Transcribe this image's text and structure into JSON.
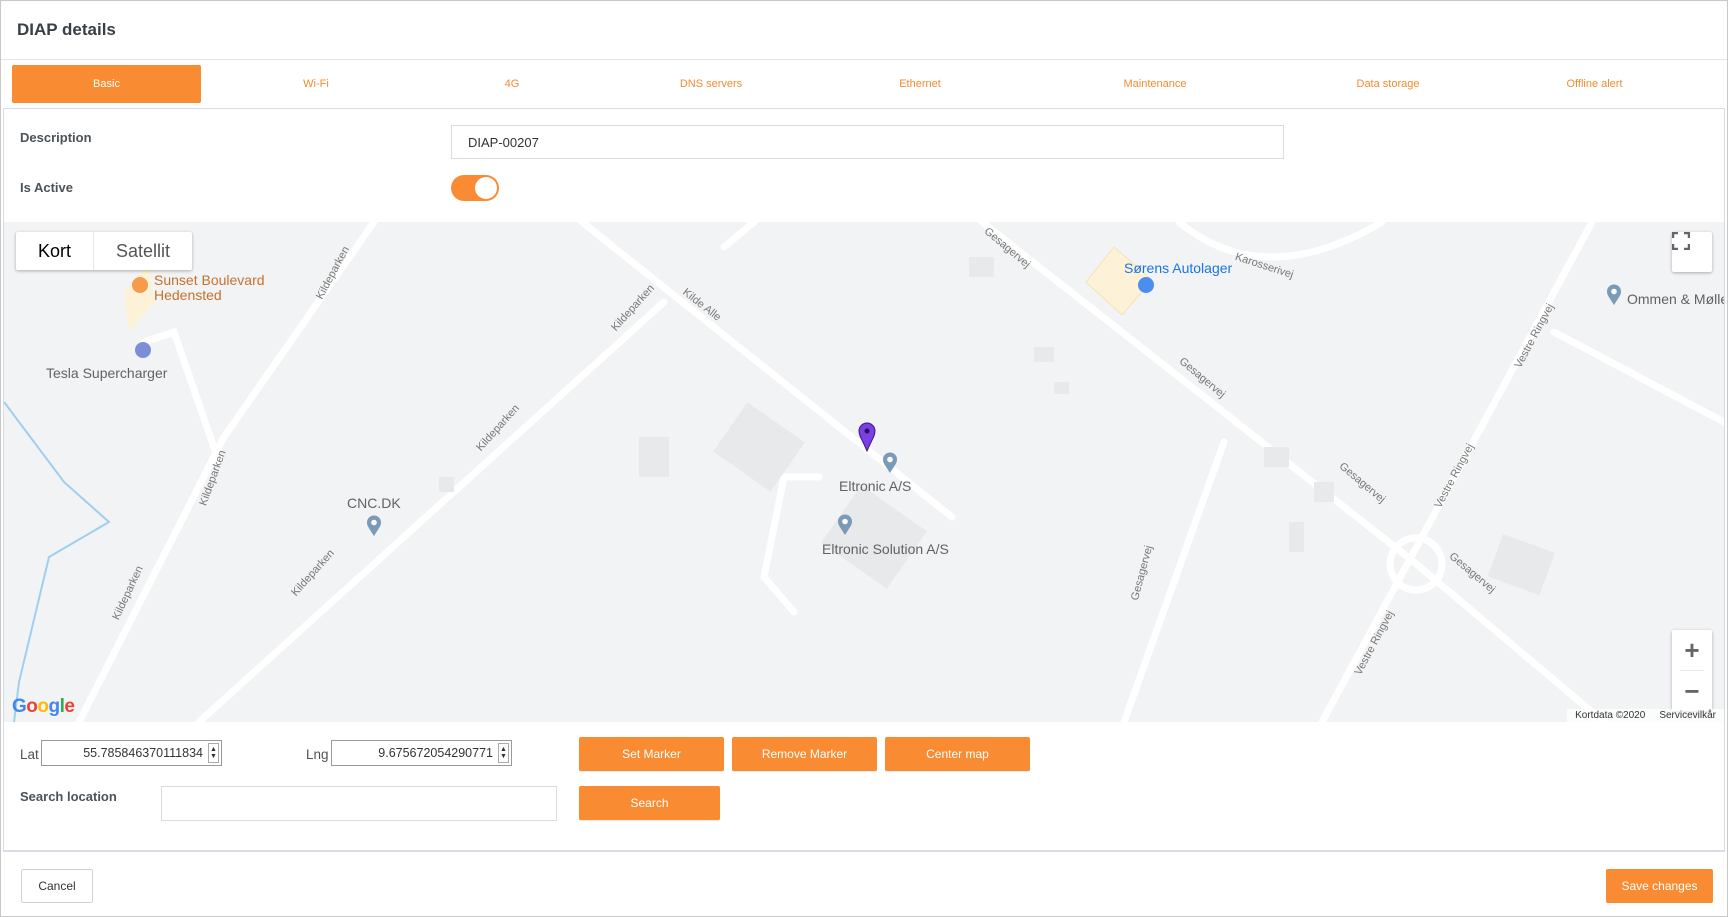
{
  "dialog": {
    "title": "DIAP details"
  },
  "tabs": [
    {
      "label": "Basic"
    },
    {
      "label": "Wi-Fi"
    },
    {
      "label": "4G"
    },
    {
      "label": "DNS servers"
    },
    {
      "label": "Ethernet"
    },
    {
      "label": "Maintenance"
    },
    {
      "label": "Data storage"
    },
    {
      "label": "Offline alert"
    }
  ],
  "form": {
    "description_label": "Description",
    "description_value": "DIAP-00207",
    "is_active_label": "Is Active",
    "is_active": true
  },
  "map": {
    "type_map": "Kort",
    "type_satellite": "Satellit",
    "places": {
      "sunset1": "Sunset Boulevard",
      "sunset2": "Hedensted",
      "tesla": "Tesla Supercharger",
      "cnc": "CNC.DK",
      "eltronic": "Eltronic A/S",
      "eltronic_solution": "Eltronic Solution A/S",
      "sorens": "Sørens Autolager",
      "ommen": "Ommen & Mølle"
    },
    "roads": {
      "kildeparken": "Kildeparken",
      "kilde_alle": "Kilde Alle",
      "gesagervej": "Gesagervej",
      "karosserivej": "Karosserivej",
      "vestre_ringvej": "Vestre Ringvej"
    },
    "logo": "Google",
    "attribution": "Kortdata ©2020",
    "terms": "Servicevilkår",
    "zoom_in": "+",
    "zoom_out": "−"
  },
  "coords": {
    "lat_label": "Lat",
    "lat_value": "55.785846370111834",
    "lng_label": "Lng",
    "lng_value": "9.675672054290771"
  },
  "buttons": {
    "set_marker": "Set Marker",
    "remove_marker": "Remove Marker",
    "center_map": "Center map",
    "search": "Search",
    "cancel": "Cancel",
    "save": "Save changes"
  },
  "search": {
    "label": "Search location",
    "value": ""
  },
  "colors": {
    "accent": "#f98c32",
    "marker": "#7b3fe4",
    "tab_text": "#f58a2c"
  }
}
